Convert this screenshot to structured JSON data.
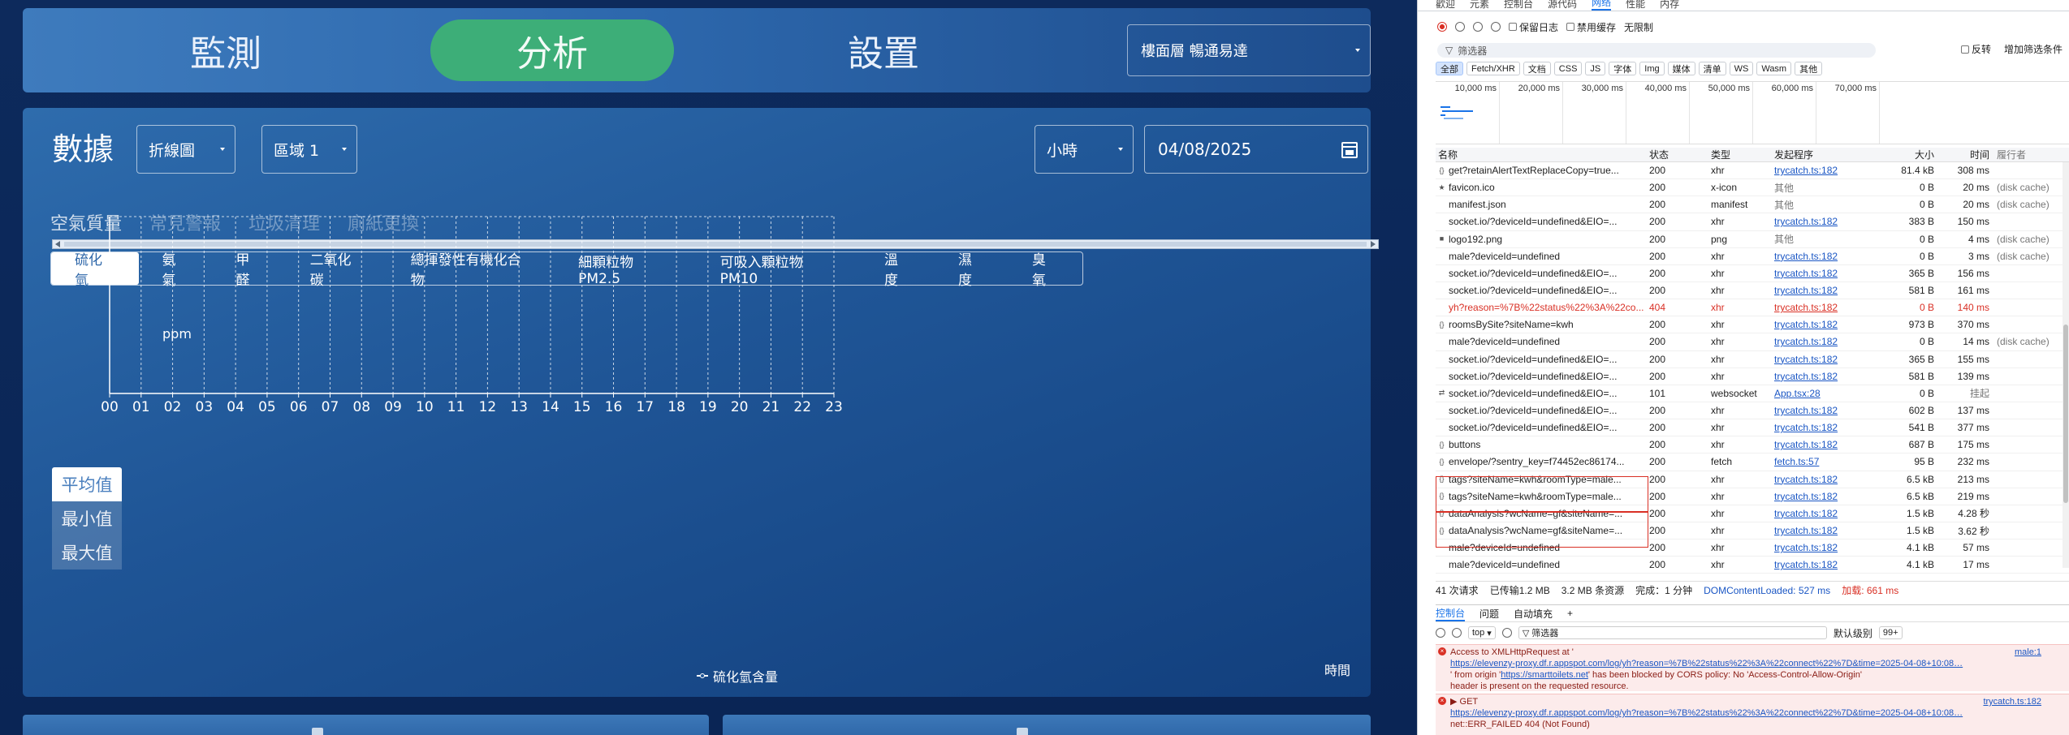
{
  "nav": {
    "tabs": [
      {
        "label": "監測",
        "active": false
      },
      {
        "label": "分析",
        "active": true
      },
      {
        "label": "設置",
        "active": false
      }
    ],
    "site_select": "樓面層 暢通易達",
    "accent": "#3dae78"
  },
  "panel": {
    "title": "數據",
    "chart_type": "折線圖",
    "zone": "區域 1",
    "granularity": "小時",
    "date": "04/08/2025",
    "categories": [
      "空氣質量",
      "常見警報",
      "垃圾清理",
      "廁紙更換"
    ],
    "metrics": [
      "硫化氫",
      "氨氣",
      "甲醛",
      "二氧化碳",
      "總揮發性有機化合物",
      "細顆粒物PM2.5",
      "可吸入顆粒物PM10",
      "溫度",
      "濕度",
      "臭氧"
    ],
    "stats": [
      "平均值",
      "最小值",
      "最大值"
    ]
  },
  "chart_data": {
    "type": "line",
    "x": [
      "00",
      "01",
      "02",
      "03",
      "04",
      "05",
      "06",
      "07",
      "08",
      "09",
      "10",
      "11",
      "12",
      "13",
      "14",
      "15",
      "16",
      "17",
      "18",
      "19",
      "20",
      "21",
      "22",
      "23"
    ],
    "series": [
      {
        "name": "硫化氫含量",
        "values": []
      }
    ],
    "ylabel": "ppm",
    "xlabel": "時間",
    "grid": true,
    "legend": "bottom-center"
  },
  "devtools": {
    "tabs": [
      "歡迎",
      "元素",
      "控制台",
      "源代码",
      "网络",
      "性能",
      "内存"
    ],
    "active_tab": "网络",
    "toolbar": {
      "preserve_log": "保留日志",
      "disable_cache": "禁用缓存",
      "throttle": "无限制"
    },
    "filter": {
      "placeholder": "筛选器",
      "invert": "反转",
      "more": "增加筛选条件"
    },
    "type_filters": [
      "全部",
      "Fetch/XHR",
      "文档",
      "CSS",
      "JS",
      "字体",
      "Img",
      "媒体",
      "清单",
      "WS",
      "Wasm",
      "其他"
    ],
    "overview_ticks": [
      "10,000 ms",
      "20,000 ms",
      "30,000 ms",
      "40,000 ms",
      "50,000 ms",
      "60,000 ms",
      "70,000 ms"
    ],
    "columns": [
      "名称",
      "状态",
      "类型",
      "发起程序",
      "大小",
      "时间",
      "履行者"
    ],
    "rows": [
      {
        "icon": "{}",
        "name": "get?retainAlertTextReplaceCopy=true...",
        "status": "200",
        "type": "xhr",
        "initiator": "trycatch.ts:182",
        "link": true,
        "size": "81.4 kB",
        "time": "308 ms",
        "perf": ""
      },
      {
        "icon": "★",
        "name": "favicon.ico",
        "status": "200",
        "type": "x-icon",
        "initiator": "其他",
        "link": false,
        "size": "0 B",
        "time": "20 ms",
        "perf": "(disk cache)"
      },
      {
        "icon": "",
        "name": "manifest.json",
        "status": "200",
        "type": "manifest",
        "initiator": "其他",
        "link": false,
        "size": "0 B",
        "time": "20 ms",
        "perf": "(disk cache)"
      },
      {
        "icon": "",
        "name": "socket.io/?deviceId=undefined&EIO=...",
        "status": "200",
        "type": "xhr",
        "initiator": "trycatch.ts:182",
        "link": true,
        "size": "383 B",
        "time": "150 ms",
        "perf": ""
      },
      {
        "icon": "■",
        "name": "logo192.png",
        "status": "200",
        "type": "png",
        "initiator": "其他",
        "link": false,
        "size": "0 B",
        "time": "4 ms",
        "perf": "(disk cache)"
      },
      {
        "icon": "",
        "name": "male?deviceId=undefined",
        "status": "200",
        "type": "xhr",
        "initiator": "trycatch.ts:182",
        "link": true,
        "size": "0 B",
        "time": "3 ms",
        "perf": "(disk cache)"
      },
      {
        "icon": "",
        "name": "socket.io/?deviceId=undefined&EIO=...",
        "status": "200",
        "type": "xhr",
        "initiator": "trycatch.ts:182",
        "link": true,
        "size": "365 B",
        "time": "156 ms",
        "perf": ""
      },
      {
        "icon": "",
        "name": "socket.io/?deviceId=undefined&EIO=...",
        "status": "200",
        "type": "xhr",
        "initiator": "trycatch.ts:182",
        "link": true,
        "size": "581 B",
        "time": "161 ms",
        "perf": ""
      },
      {
        "icon": "",
        "name": "yh?reason=%7B%22status%22%3A%22co...",
        "status": "404",
        "type": "xhr",
        "initiator": "trycatch.ts:182",
        "link": true,
        "size": "0 B",
        "time": "140 ms",
        "perf": "",
        "error": true
      },
      {
        "icon": "{}",
        "name": "roomsBySite?siteName=kwh",
        "status": "200",
        "type": "xhr",
        "initiator": "trycatch.ts:182",
        "link": true,
        "size": "973 B",
        "time": "370 ms",
        "perf": ""
      },
      {
        "icon": "",
        "name": "male?deviceId=undefined",
        "status": "200",
        "type": "xhr",
        "initiator": "trycatch.ts:182",
        "link": true,
        "size": "0 B",
        "time": "14 ms",
        "perf": "(disk cache)"
      },
      {
        "icon": "",
        "name": "socket.io/?deviceId=undefined&EIO=...",
        "status": "200",
        "type": "xhr",
        "initiator": "trycatch.ts:182",
        "link": true,
        "size": "365 B",
        "time": "155 ms",
        "perf": ""
      },
      {
        "icon": "",
        "name": "socket.io/?deviceId=undefined&EIO=...",
        "status": "200",
        "type": "xhr",
        "initiator": "trycatch.ts:182",
        "link": true,
        "size": "581 B",
        "time": "139 ms",
        "perf": ""
      },
      {
        "icon": "⇄",
        "name": "socket.io/?deviceId=undefined&EIO=...",
        "status": "101",
        "type": "websocket",
        "initiator": "App.tsx:28",
        "link": true,
        "size": "0 B",
        "time": "挂起",
        "perf": ""
      },
      {
        "icon": "",
        "name": "socket.io/?deviceId=undefined&EIO=...",
        "status": "200",
        "type": "xhr",
        "initiator": "trycatch.ts:182",
        "link": true,
        "size": "602 B",
        "time": "137 ms",
        "perf": ""
      },
      {
        "icon": "",
        "name": "socket.io/?deviceId=undefined&EIO=...",
        "status": "200",
        "type": "xhr",
        "initiator": "trycatch.ts:182",
        "link": true,
        "size": "541 B",
        "time": "377 ms",
        "perf": ""
      },
      {
        "icon": "{}",
        "name": "buttons",
        "status": "200",
        "type": "xhr",
        "initiator": "trycatch.ts:182",
        "link": true,
        "size": "687 B",
        "time": "175 ms",
        "perf": ""
      },
      {
        "icon": "{}",
        "name": "envelope/?sentry_key=f74452ec86174...",
        "status": "200",
        "type": "fetch",
        "initiator": "fetch.ts:57",
        "link": true,
        "size": "95 B",
        "time": "232 ms",
        "perf": ""
      },
      {
        "icon": "{}",
        "name": "tags?siteName=kwh&roomType=male...",
        "status": "200",
        "type": "xhr",
        "initiator": "trycatch.ts:182",
        "link": true,
        "size": "6.5 kB",
        "time": "213 ms",
        "perf": ""
      },
      {
        "icon": "{}",
        "name": "tags?siteName=kwh&roomType=male...",
        "status": "200",
        "type": "xhr",
        "initiator": "trycatch.ts:182",
        "link": true,
        "size": "6.5 kB",
        "time": "219 ms",
        "perf": ""
      },
      {
        "icon": "{}",
        "name": "dataAnalysis?wcName=gf&siteName=...",
        "status": "200",
        "type": "xhr",
        "initiator": "trycatch.ts:182",
        "link": true,
        "size": "1.5 kB",
        "time": "4.28 秒",
        "perf": ""
      },
      {
        "icon": "{}",
        "name": "dataAnalysis?wcName=gf&siteName=...",
        "status": "200",
        "type": "xhr",
        "initiator": "trycatch.ts:182",
        "link": true,
        "size": "1.5 kB",
        "time": "3.62 秒",
        "perf": ""
      },
      {
        "icon": "",
        "name": "male?deviceId=undefined",
        "status": "200",
        "type": "xhr",
        "initiator": "trycatch.ts:182",
        "link": true,
        "size": "4.1 kB",
        "time": "57 ms",
        "perf": ""
      },
      {
        "icon": "",
        "name": "male?deviceId=undefined",
        "status": "200",
        "type": "xhr",
        "initiator": "trycatch.ts:182",
        "link": true,
        "size": "4.1 kB",
        "time": "17 ms",
        "perf": ""
      }
    ],
    "summary": {
      "requests": "41 次请求",
      "transferred": "已传输1.2 MB",
      "resources": "3.2 MB 条资源",
      "finish": "完成：1 分钟",
      "dcl": "DOMContentLoaded: 527 ms",
      "load": "加载: 661 ms"
    },
    "drawer_tabs": [
      "控制台",
      "问题",
      "自动填充"
    ],
    "console": {
      "context": "top",
      "filter": "筛选器",
      "level": "默认级别",
      "issues": "99+"
    },
    "messages": [
      {
        "line1": "Access to XMLHttpRequest at '",
        "src": "male:1",
        "url": "https://elevenzy-proxy.df.r.appspot.com/log/yh?reason=%7B%22status%22%3A%22connect%22%7D&time=2025-04-08+10:08…",
        "line3a": "' from origin '",
        "origin": "https://smarttoilets.net",
        "line3b": "' has been blocked by CORS policy: No 'Access-Control-Allow-Origin'",
        "line4": "header is present on the requested resource."
      },
      {
        "line1": "▶ GET",
        "src": "trycatch.ts:182",
        "url": "https://elevenzy-proxy.df.r.appspot.com/log/yh?reason=%7B%22status%22%3A%22connect%22%7D&time=2025-04-08+10:08…",
        "line3a": "net::ERR_FAILED 404 (Not Found)",
        "origin": "",
        "line3b": "",
        "line4": ""
      }
    ]
  }
}
